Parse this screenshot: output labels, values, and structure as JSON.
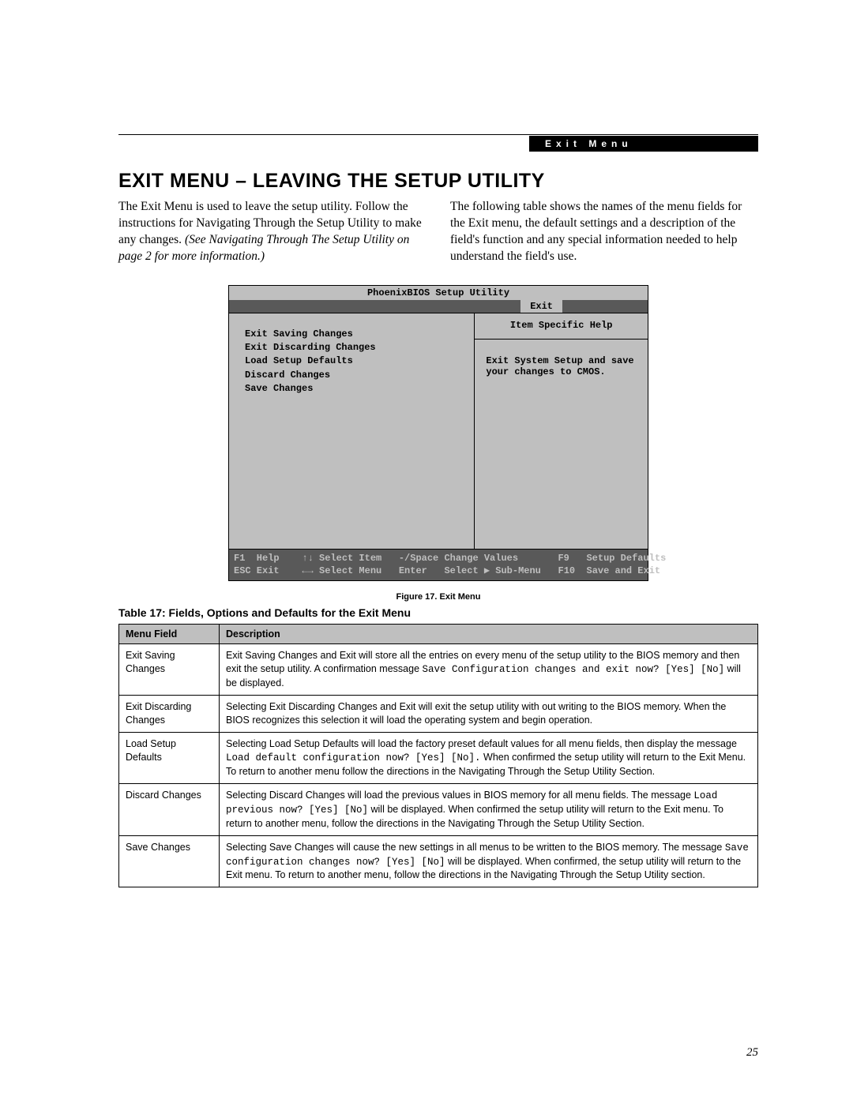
{
  "header_label": "Exit Menu",
  "heading": "EXIT MENU – LEAVING THE SETUP UTILITY",
  "intro_left_plain": "The Exit Menu is used to leave the setup utility. Follow the instructions for Navigating Through the Setup Utility to make any changes. ",
  "intro_left_italic": "(See Navigating Through The Setup Utility on page 2 for more information.)",
  "intro_right": "The following table shows the names of the menu fields for the Exit menu, the default settings and a description of the field's function and any special information needed to help understand the field's use.",
  "bios": {
    "title": "PhoenixBIOS Setup Utility",
    "active_tab": "Exit",
    "left_items": [
      "Exit Saving Changes",
      "Exit Discarding Changes",
      "Load Setup Defaults",
      "Discard Changes",
      "Save Changes"
    ],
    "help_title": "Item Specific Help",
    "help_body": "Exit System Setup and save your changes to CMOS.",
    "footer_row1": "F1  Help    ↑↓ Select Item   -/Space Change Values       F9   Setup Defaults",
    "footer_row2": "ESC Exit    ←→ Select Menu   Enter   Select ▶ Sub-Menu   F10  Save and Exit"
  },
  "figure_caption": "Figure 17.  Exit Menu",
  "table_caption": "Table 17: Fields, Options and Defaults for the Exit Menu",
  "table_headers": {
    "col1": "Menu Field",
    "col2": "Description"
  },
  "rows": [
    {
      "field": "Exit Saving Changes",
      "desc_pre": "Exit Saving Changes and Exit will store all the entries on every menu of the setup utility to the BIOS memory and then exit the setup utility. A confirmation message ",
      "desc_code": "Save Configuration changes and exit now? [Yes] [No]",
      "desc_post": " will be displayed."
    },
    {
      "field": "Exit Discarding Changes",
      "desc_pre": "Selecting Exit Discarding Changes and Exit will exit the setup utility with out writing to the BIOS memory. When the BIOS recognizes this selection it will load the operating system and begin operation.",
      "desc_code": "",
      "desc_post": ""
    },
    {
      "field": "Load Setup Defaults",
      "desc_pre": "Selecting Load Setup Defaults will load the factory preset default values for all menu fields, then display the message ",
      "desc_code": "Load default configuration now? [Yes] [No].",
      "desc_post": " When confirmed the setup utility will return to the Exit Menu. To return to another menu follow the directions in the Navigating Through the Setup Utility Section."
    },
    {
      "field": "Discard Changes",
      "desc_pre": "Selecting Discard Changes will load the previous values in BIOS memory for all menu fields. The message ",
      "desc_code": "Load previous now? [Yes] [No]",
      "desc_post": " will be displayed. When confirmed the setup utility will return to the Exit menu. To return to another menu, follow the directions in the Navigating Through the Setup Utility Section."
    },
    {
      "field": "Save Changes",
      "desc_pre": "Selecting Save Changes will cause the new settings in all menus to be written to the BIOS memory. The message ",
      "desc_code": "Save configuration changes now? [Yes] [No]",
      "desc_post": " will be displayed. When confirmed, the setup utility will return to the Exit menu. To return to another menu, follow the directions in the Navigating Through the Setup Utility section."
    }
  ],
  "page_number": "25"
}
